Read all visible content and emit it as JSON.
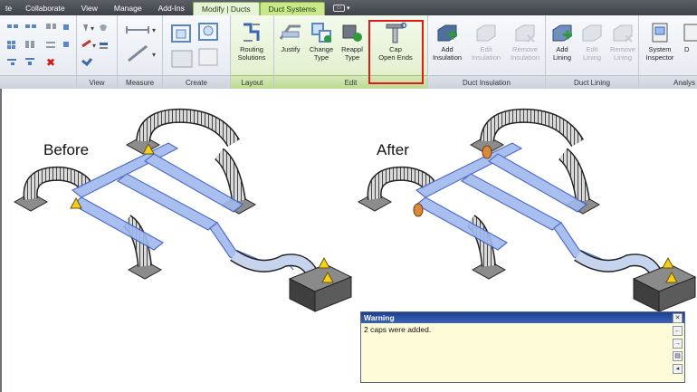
{
  "tabs": [
    {
      "label": "te"
    },
    {
      "label": "Collaborate"
    },
    {
      "label": "View"
    },
    {
      "label": "Manage"
    },
    {
      "label": "Add-Ins"
    },
    {
      "label": "Modify | Ducts"
    },
    {
      "label": "Duct Systems"
    }
  ],
  "panels": {
    "view": "View",
    "measure": "Measure",
    "create": "Create",
    "layout": "Layout",
    "edit": "Edit",
    "duct_insulation": "Duct Insulation",
    "duct_lining": "Duct Lining",
    "analysis": "Analys"
  },
  "buttons": {
    "routing_solutions": [
      "Routing",
      "Solutions"
    ],
    "justify": "Justify",
    "change_type": [
      "Change",
      "Type"
    ],
    "reapply_type": [
      "Reappl",
      "Type"
    ],
    "cap_open_ends": [
      "Cap",
      "Open Ends"
    ],
    "add_insulation": [
      "Add",
      "Insulation"
    ],
    "edit_insulation": [
      "Edit",
      "Insulation"
    ],
    "remove_insulation": [
      "Remove",
      "Insulation"
    ],
    "add_lining": [
      "Add",
      "Lining"
    ],
    "edit_lining": [
      "Edit",
      "Lining"
    ],
    "remove_lining": [
      "Remove",
      "Lining"
    ],
    "system_inspector": [
      "System",
      "Inspector"
    ],
    "cut_d": "D"
  },
  "captions": {
    "before": "Before",
    "after": "After"
  },
  "warning": {
    "title": "Warning",
    "message": "2 caps were added."
  },
  "colors": {
    "duct_blue": "#9fb9ee",
    "duct_stroke": "#3f5fc0",
    "flex_duct": "#2c2c2c",
    "warning_yellow": "#f5cf1c",
    "cap_orange": "#d88a3c",
    "ribbon_green": "#c8e88a",
    "highlight_red": "#e01919"
  }
}
